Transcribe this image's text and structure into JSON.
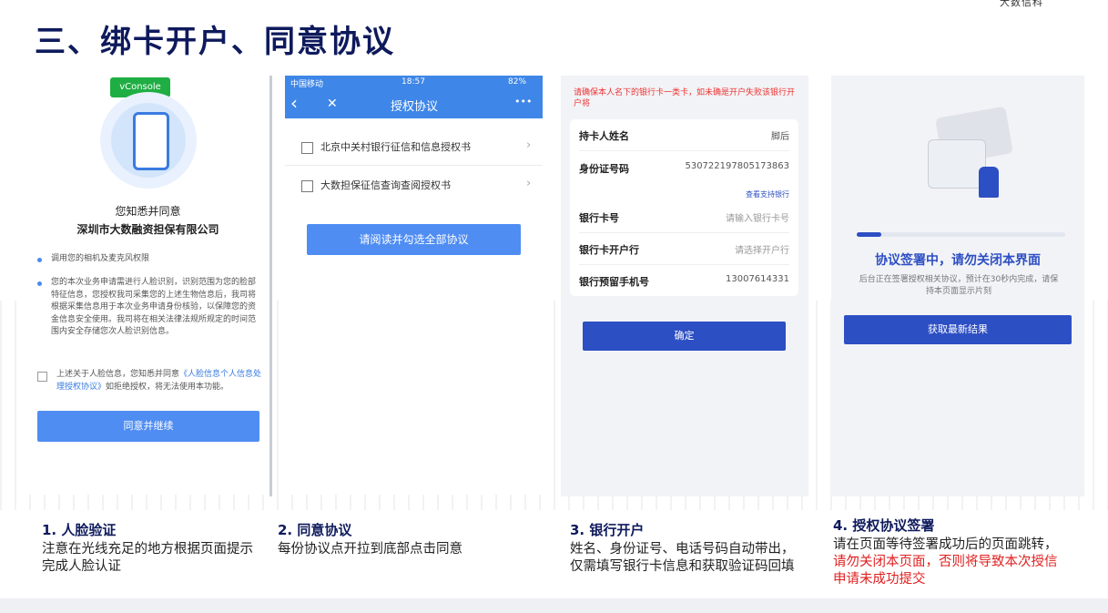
{
  "brand": "大数信科",
  "page_title": "三、绑卡开户、同意协议",
  "panel1": {
    "vconsole": "vConsole",
    "agree_line1": "您知悉并同意",
    "agree_line2": "深圳市大数融资担保有限公司",
    "item1": "调用您的相机及麦克风权限",
    "item2": "您的本次业务申请需进行人脸识别，识别范围为您的脸部特征信息，您授权我司采集您的上述生物信息后，我司将根据采集信息用于本次业务申请身份核验，以保障您的资金信息安全使用。我司将在相关法律法规所规定的时间范围内安全存储您次人脸识别信息。",
    "consent_pre": "上述关于人脸信息，您知悉并同意",
    "consent_link": "《人脸信息个人信息处理授权协议》",
    "consent_post": "如拒绝授权，将无法使用本功能。",
    "button": "同意并继续"
  },
  "panel2": {
    "status_carrier": "中国移动",
    "status_time": "18:57",
    "status_battery": "82%",
    "back_icon": "‹",
    "close_icon": "✕",
    "title": "授权协议",
    "more_icon": "•••",
    "items": [
      "北京中关村银行征信和信息授权书",
      "大数担保征信查询查阅授权书"
    ],
    "button": "请阅读并勾选全部协议"
  },
  "panel3": {
    "warning": "请确保本人名下的银行卡一类卡，如未确是开户失败该银行开户将",
    "name_label": "持卡人姓名",
    "name_value": "脚后",
    "id_label": "身份证号码",
    "id_value": "530722197805173863",
    "supported_banks": "查看支持银行",
    "card_label": "银行卡号",
    "card_placeholder": "请输入银行卡号",
    "bank_label": "银行卡开户行",
    "bank_placeholder": "请选择开户行",
    "phone_label": "银行预留手机号",
    "phone_value": "13007614331",
    "button": "确定"
  },
  "panel4": {
    "progress_fraction": 0.12,
    "status": "协议签署中，请勿关闭本界面",
    "sub": "后台正在签署授权相关协议，预计在30秒内完成，请保持本页面显示片刻",
    "button": "获取最新结果"
  },
  "captions": [
    {
      "title": "1. 人脸验证",
      "desc": "注意在光线充足的地方根据页面提示完成人脸认证"
    },
    {
      "title": "2. 同意协议",
      "desc": "每份协议点开拉到底部点击同意"
    },
    {
      "title": "3. 银行开户",
      "desc": "姓名、身份证号、电话号码自动带出，仅需填写银行卡信息和获取验证码回填"
    },
    {
      "title": "4. 授权协议签署",
      "desc_normal": "请在页面等待签署成功后的页面跳转，",
      "desc_red": "请勿关闭本页面，否则将导致本次授信申请未成功提交"
    }
  ],
  "colors": {
    "title": "#0e1a5c",
    "primary": "#2d4fc4",
    "button_light": "#4f8df3",
    "warning": "#e02020"
  }
}
